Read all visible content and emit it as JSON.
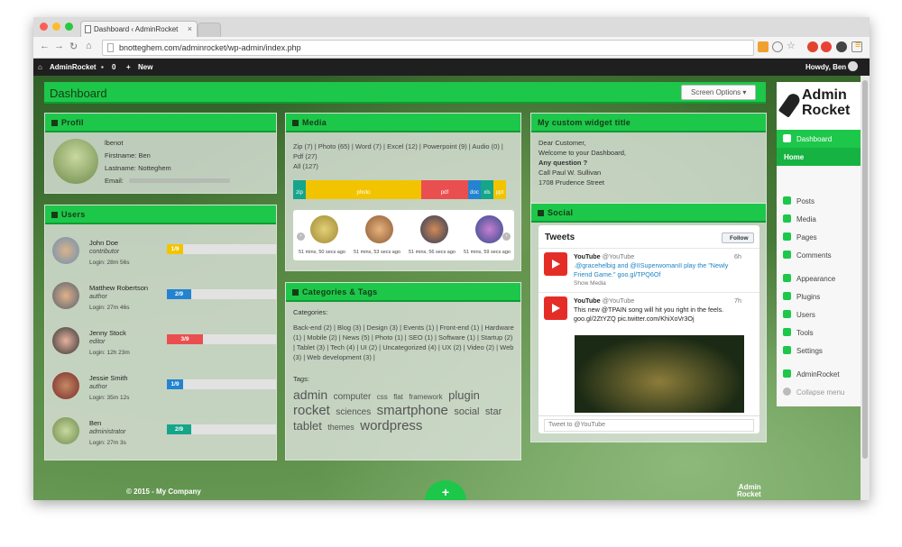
{
  "browser": {
    "tab_title": "Dashboard ‹ AdminRocket",
    "url": "bnotteghem.com/adminrocket/wp-admin/index.php"
  },
  "adminbar": {
    "site_name": "AdminRocket",
    "comments_count": "0",
    "new_label": "New",
    "howdy": "Howdy, Ben"
  },
  "page": {
    "title": "Dashboard",
    "screen_options": "Screen Options"
  },
  "profil": {
    "title": "Profil",
    "username": "lbenot",
    "firstname": "Firstname: Ben",
    "lastname": "Lastname: Notteghem",
    "email_label": "Email:"
  },
  "users": {
    "title": "Users",
    "rows": [
      {
        "name": "John Doe",
        "role": "contributor",
        "login": "Login: 28m 56s",
        "progress": "1/9",
        "color": "#f2c400",
        "fraction": 0.11
      },
      {
        "name": "Matthew Robertson",
        "role": "author",
        "login": "Login: 27m 46s",
        "progress": "2/9",
        "color": "#2483d0",
        "fraction": 0.22
      },
      {
        "name": "Jenny Stock",
        "role": "editor",
        "login": "Login: 12h 23m",
        "progress": "3/9",
        "color": "#ea4f4f",
        "fraction": 0.33
      },
      {
        "name": "Jessie Smith",
        "role": "author",
        "login": "Login: 35m 12s",
        "progress": "1/9",
        "color": "#2483d0",
        "fraction": 0.11
      },
      {
        "name": "Ben",
        "role": "administrator",
        "login": "Login: 27m 3s",
        "progress": "2/9",
        "color": "#15a58a",
        "fraction": 0.22
      }
    ]
  },
  "media": {
    "title": "Media",
    "links": "Zip (7)  |  Photo (65)  |  Word (7)  |  Excel (12)  |  Powerpoint (9)  |  Audio (0)  |  Pdf (27)",
    "all": "All (127)",
    "bars": [
      {
        "label": "zip",
        "color": "#15a58a"
      },
      {
        "label": "photo",
        "color": "#f2c400"
      },
      {
        "label": "pdf",
        "color": "#ea4f4f"
      },
      {
        "label": "doc",
        "color": "#2483d0"
      },
      {
        "label": "xls",
        "color": "#15a58a"
      },
      {
        "label": "ppt",
        "color": "#f2c400"
      }
    ],
    "captions": [
      "51 mins, 50 secs ago",
      "51 mins, 53 secs ago",
      "51 mins, 56 secs ago",
      "51 mins, 59 secs ago"
    ]
  },
  "categories": {
    "title": "Categories & Tags",
    "categories_label": "Categories:",
    "categories_text": "Back-end (2)  |  Blog (3)  |  Design (3)  |  Events (1)  |  Front-end (1)  |  Hardware (1)  |  Mobile (2)  |  News (5)  |  Photo (1)  |  SEO (1)  |  Software (1)  |  Startup (2)  |  Tablet (3)  |  Tech (4)  |  UI (2)  |  Uncategorized (4)  |  UX (2)  |  Video (2)  |  Web (3)  |  Web development (3)  |",
    "tags_label": "Tags:",
    "tags": [
      {
        "t": "admin",
        "s": "14px"
      },
      {
        "t": "computer",
        "s": "10px"
      },
      {
        "t": "css",
        "s": "8px"
      },
      {
        "t": "flat",
        "s": "8px"
      },
      {
        "t": "framework",
        "s": "8px"
      },
      {
        "t": "plugin",
        "s": "13px"
      },
      {
        "t": "rocket",
        "s": "15px"
      },
      {
        "t": "sciences",
        "s": "10px"
      },
      {
        "t": "smartphone",
        "s": "15px"
      },
      {
        "t": "social",
        "s": "11px"
      },
      {
        "t": "star",
        "s": "11px"
      },
      {
        "t": "tablet",
        "s": "13px"
      },
      {
        "t": "themes",
        "s": "9px"
      },
      {
        "t": "wordpress",
        "s": "15px"
      }
    ]
  },
  "custom_widget": {
    "title": "My custom widget title",
    "lines": [
      "Dear Customer,",
      "Welcome to your Dashboard,",
      "Any question ?",
      "Call Paul W. Sullivan",
      "1708 Prudence Street"
    ]
  },
  "social": {
    "title": "Social",
    "tweets_header": "Tweets",
    "follow": "Follow",
    "tweet1": {
      "name": "YouTube",
      "handle": "@YouTube",
      "time": "6h",
      "text": ".@gracehelbig and @IISuperwomanII play the \"Newly Friend Game.\" goo.gl/TPQ6Of",
      "media": "Show Media"
    },
    "tweet2": {
      "name": "YouTube",
      "handle": "@YouTube",
      "time": "7h",
      "text": "This new @TPAIN song will hit you right in the feels. goo.gl/2ZtYZQ pic.twitter.com/KhiXoVr3Oj"
    },
    "compose_placeholder": "Tweet to @YouTube"
  },
  "sidebar": {
    "logo_line1": "Admin",
    "logo_line2": "Rocket",
    "dashboard": "Dashboard",
    "home": "Home",
    "items": [
      "Posts",
      "Media",
      "Pages",
      "Comments",
      "Appearance",
      "Plugins",
      "Users",
      "Tools",
      "Settings",
      "AdminRocket",
      "Collapse menu"
    ]
  },
  "footer": {
    "copyright": "© 2015 - My Company",
    "fab": "+",
    "logo1": "Admin",
    "logo2": "Rocket"
  }
}
